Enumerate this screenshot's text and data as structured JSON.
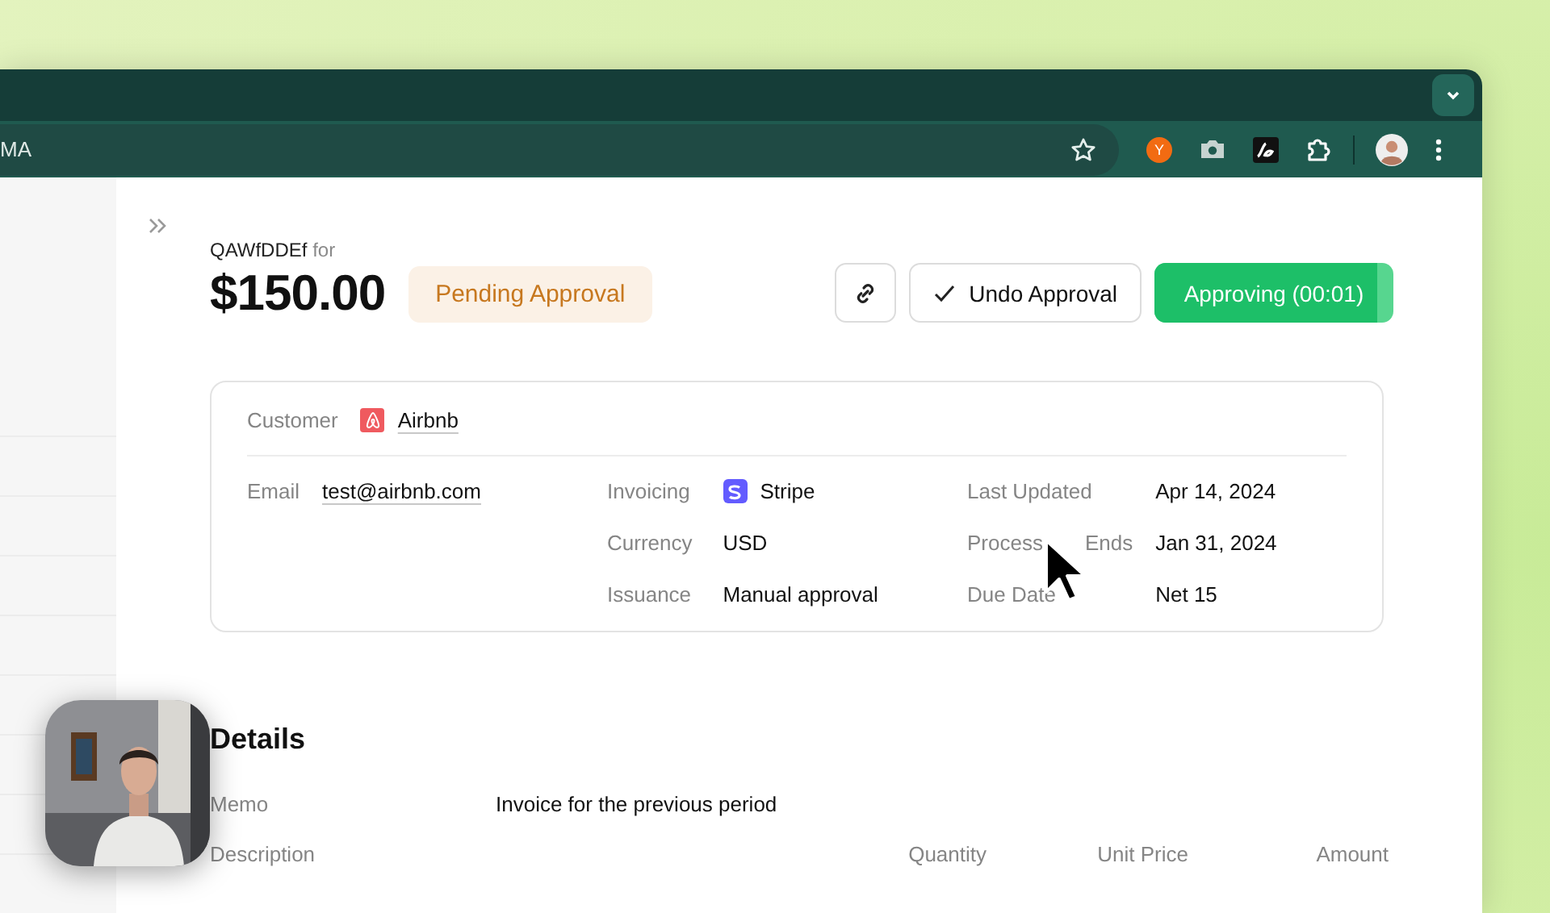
{
  "browser": {
    "address": "MA",
    "profile_badge": "Y"
  },
  "invoice": {
    "id": "QAWfDDEf",
    "for_label": "for",
    "amount": "$150.00",
    "status": "Pending Approval",
    "actions": [
      {
        "kind": "link"
      },
      {
        "kind": "undo",
        "label": "Undo Approval"
      },
      {
        "kind": "progress",
        "label": "Approving (00:01)",
        "level": 0.93
      }
    ]
  },
  "customer": {
    "label": "Customer",
    "name": "Airbnb"
  },
  "fields": [
    {
      "label": "Email",
      "value": "test@airbnb.com",
      "kind": "link"
    },
    {
      "label": "Invoicing",
      "value": "Stripe",
      "kind": "stripe"
    },
    {
      "label": "Last Updated",
      "value": "Apr 14, 2024",
      "kind": "plain"
    },
    {
      "label": "Currency",
      "value": "USD",
      "kind": "plain"
    },
    {
      "label_parts": [
        "Process",
        "Ends"
      ],
      "value": "Jan 31, 2024",
      "kind": "plain"
    },
    {
      "label": "Issuance",
      "value": "Manual approval",
      "kind": "plain"
    },
    {
      "label": "Due Date",
      "value": "Net 15",
      "kind": "plain"
    }
  ],
  "details": {
    "title": "Details",
    "memo_label": "Memo",
    "memo": "Invoice for the previous period",
    "columns": [
      "Description",
      "Quantity",
      "Unit Price",
      "Amount"
    ]
  }
}
